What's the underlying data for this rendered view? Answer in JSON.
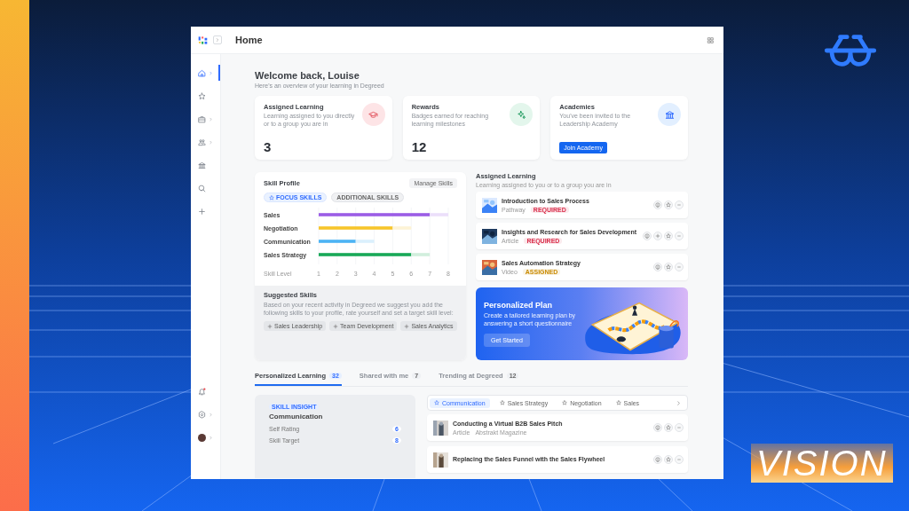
{
  "brand": {
    "text": "VISION"
  },
  "header": {
    "title": "Home"
  },
  "sidebar": {
    "items": [
      {
        "kind": "home",
        "selected": true,
        "chevron": true
      },
      {
        "kind": "star",
        "selected": false,
        "chevron": false
      },
      {
        "kind": "briefcase",
        "selected": false,
        "chevron": true
      },
      {
        "kind": "people",
        "selected": false,
        "chevron": true
      },
      {
        "kind": "bank",
        "selected": false,
        "chevron": false
      },
      {
        "kind": "search",
        "selected": false,
        "chevron": false
      },
      {
        "kind": "plus",
        "selected": false,
        "chevron": false
      }
    ],
    "bottom": [
      {
        "kind": "bell",
        "selected": false,
        "chevron": false,
        "alert": true
      },
      {
        "kind": "gear",
        "selected": false,
        "chevron": true,
        "alert": false
      },
      {
        "kind": "avatar",
        "selected": false,
        "chevron": true,
        "alert": false
      }
    ]
  },
  "welcome": {
    "title": "Welcome back, Louise",
    "subtitle": "Here's an overview of your learning in Degreed"
  },
  "cards": [
    {
      "kind": "count",
      "color": "#fde4e6",
      "title": "Assigned Learning",
      "text": "Learning assigned to you directly or to a group you are in",
      "value": "3"
    },
    {
      "kind": "count",
      "color": "#e3f6ec",
      "title": "Rewards",
      "text": "Badges earned for reaching learning milestones",
      "value": "12"
    },
    {
      "kind": "action",
      "color": "#e2efff",
      "title": "Academies",
      "text": "You've been invited to the Leadership Academy",
      "button": "Join Academy"
    }
  ],
  "skill_profile": {
    "title": "Skill Profile",
    "manage": "Manage Skills",
    "filters": [
      {
        "label": "FOCUS SKILLS",
        "selected": true
      },
      {
        "label": "ADDITIONAL SKILLS",
        "selected": false
      }
    ],
    "chart_data": {
      "type": "bar",
      "orientation": "horizontal",
      "stacked": true,
      "xlabel": "Skill Level",
      "categories": [
        "Sales",
        "Negotiation",
        "Communication",
        "Sales Strategy"
      ],
      "grid": true,
      "series": [
        {
          "colors": [
            "#9b5de5",
            "#f7c52b",
            "#4cb3f4",
            "#18a957"
          ],
          "values": [
            6,
            4,
            2,
            5
          ]
        },
        {
          "colors": [
            "#ebdffa",
            "#fdf3d5",
            "#dbf0fd",
            "#d1eedd"
          ],
          "values": [
            1,
            1,
            1,
            1
          ]
        }
      ],
      "xlim": [
        1,
        8
      ],
      "xticks": [
        1,
        2,
        3,
        4,
        5,
        6,
        7,
        8
      ]
    }
  },
  "suggested": {
    "title": "Suggested Skills",
    "text": "Based on your recent activity in Degreed we suggest you add the following skills to your profile, rate yourself and set a target skill level:",
    "chips": [
      "Sales Leadership",
      "Team Development",
      "Sales Analytics"
    ]
  },
  "assigned": {
    "title": "Assigned Learning",
    "subtitle": "Learning assigned to you or to a group you are in",
    "items": [
      {
        "title": "Introduction to Sales Process",
        "type": "Pathway",
        "tag": "REQUIRED",
        "color": "#d92d4a"
      },
      {
        "title": "Insights and Research for Sales Development",
        "type": "Article",
        "tag": "REQUIRED",
        "color": "#d92d4a"
      },
      {
        "title": "Sales Automation Strategy",
        "type": "Video",
        "tag": "ASSIGNED",
        "color": "#c98a00"
      }
    ]
  },
  "plan": {
    "title": "Personalized Plan",
    "text": "Create a tailored learning plan by answering a short questionnaire",
    "button": "Get Started"
  },
  "tabs": [
    {
      "label": "Personalized Learning",
      "count": "32",
      "selected": true
    },
    {
      "label": "Shared with me",
      "count": "7",
      "selected": false
    },
    {
      "label": "Trending at Degreed",
      "count": "12",
      "selected": false
    }
  ],
  "insight": {
    "badge": "SKILL INSIGHT",
    "title": "Communication",
    "rows": [
      {
        "label": "Self Rating",
        "value": "6"
      },
      {
        "label": "Skill Target",
        "value": "8"
      }
    ]
  },
  "skill_tabs": [
    {
      "label": "Communication",
      "selected": true
    },
    {
      "label": "Sales Strategy",
      "selected": false
    },
    {
      "label": "Negotiation",
      "selected": false
    },
    {
      "label": "Sales",
      "selected": false
    }
  ],
  "content": [
    {
      "title": "Conducting a Virtual B2B Sales Pitch",
      "type": "Article",
      "source": "Abstrakt Magazine"
    },
    {
      "title": "Replacing the Sales Funnel with the Sales Flywheel"
    }
  ]
}
